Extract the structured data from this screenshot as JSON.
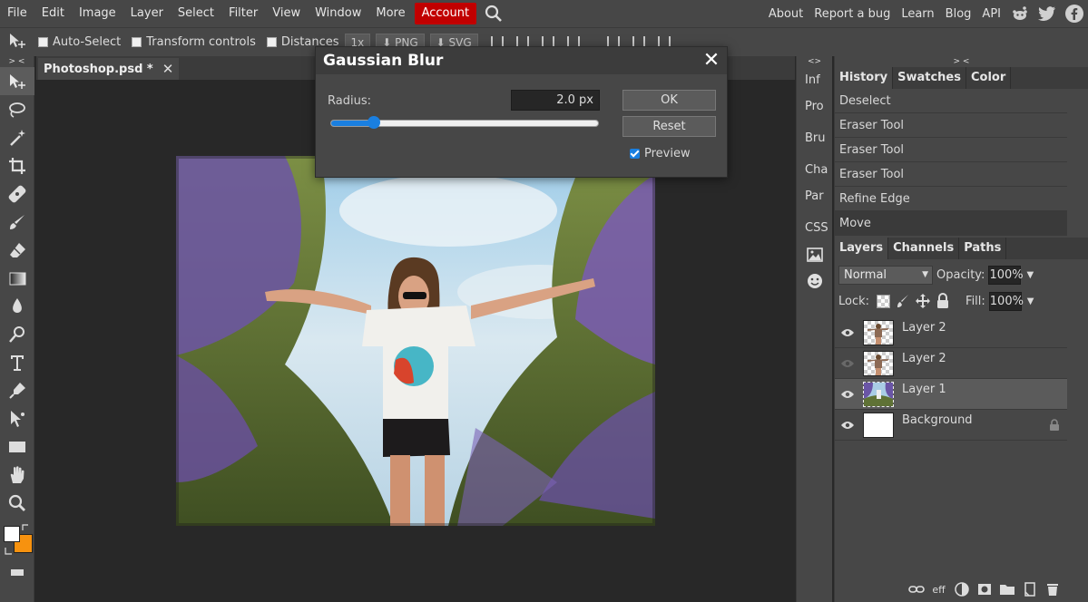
{
  "menu": {
    "items": [
      "File",
      "Edit",
      "Image",
      "Layer",
      "Select",
      "Filter",
      "View",
      "Window",
      "More"
    ],
    "account": "Account",
    "right_links": [
      "About",
      "Report a bug",
      "Learn",
      "Blog",
      "API"
    ]
  },
  "options": {
    "auto_select": "Auto-Select",
    "transform_controls": "Transform controls",
    "distances": "Distances",
    "zoom": "1x",
    "png": "PNG",
    "svg": "SVG"
  },
  "toolbar": {
    "collapse": "> <",
    "colors": {
      "foreground": "#ffffff",
      "background": "#f7920f"
    }
  },
  "document": {
    "tab_title": "Photoshop.psd *",
    "close_symbol": "✕"
  },
  "dialog": {
    "title": "Gaussian Blur",
    "close_symbol": "✕",
    "radius_label": "Radius:",
    "radius_value": "2.0 px",
    "slider_fraction": 0.16,
    "ok": "OK",
    "reset": "Reset",
    "preview": "Preview",
    "preview_checked": true
  },
  "minipanel": {
    "collapse": "<>",
    "items": [
      "Inf",
      "Pro",
      "Bru",
      "Cha",
      "Par",
      "CSS"
    ]
  },
  "rightpanel": {
    "collapse": "> <",
    "history_tabs": [
      "History",
      "Swatches",
      "Color"
    ],
    "history": [
      "Deselect",
      "Eraser Tool",
      "Eraser Tool",
      "Eraser Tool",
      "Refine Edge",
      "Move"
    ],
    "layers_tabs": [
      "Layers",
      "Channels",
      "Paths"
    ],
    "blend_mode": "Normal",
    "opacity_label": "Opacity:",
    "opacity": "100%",
    "lock_label": "Lock:",
    "fill_label": "Fill:",
    "fill": "100%",
    "layers": [
      {
        "name": "Layer 2",
        "visible": true,
        "thumb": "checker-figure",
        "selected": false
      },
      {
        "name": "Layer 2",
        "visible": false,
        "thumb": "checker-figure",
        "selected": false
      },
      {
        "name": "Layer 1",
        "visible": true,
        "thumb": "photo",
        "selected": true
      },
      {
        "name": "Background",
        "visible": true,
        "thumb": "white",
        "selected": false,
        "locked": true
      }
    ],
    "bottom_eff": "eff"
  },
  "colors": {
    "account_bg": "#c10000",
    "accent_blue": "#1a7fe0",
    "panel_bg": "#474747",
    "canvas_bg": "#282828"
  }
}
